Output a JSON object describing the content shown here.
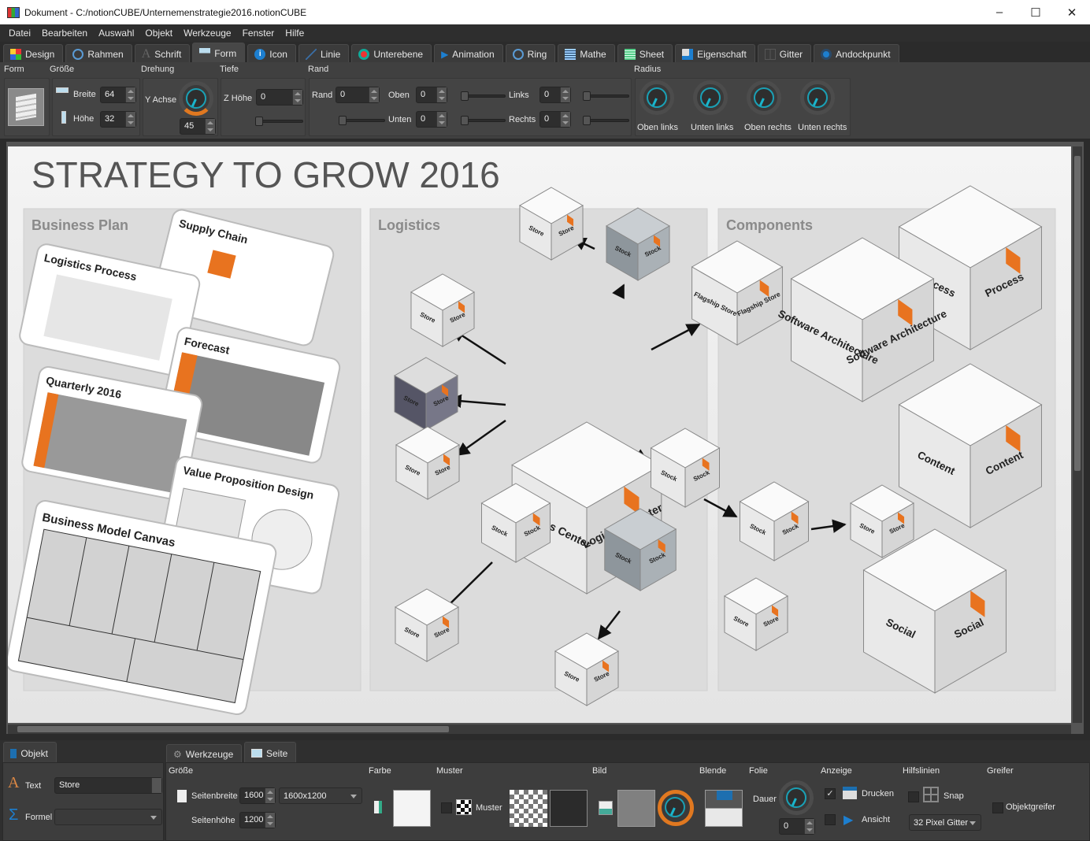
{
  "window": {
    "title": "Dokument - C:/notionCUBE/Unternemenstrategie2016.notionCUBE",
    "minimize": "–",
    "maximize": "☐",
    "close": "✕"
  },
  "menu": [
    "Datei",
    "Bearbeiten",
    "Auswahl",
    "Objekt",
    "Werkzeuge",
    "Fenster",
    "Hilfe"
  ],
  "ribbon_tabs": [
    {
      "label": "Design",
      "icon": "palette-icon"
    },
    {
      "label": "Rahmen",
      "icon": "ring-icon"
    },
    {
      "label": "Schrift",
      "icon": "font-icon"
    },
    {
      "label": "Form",
      "icon": "shape-icon",
      "active": true
    },
    {
      "label": "Icon",
      "icon": "info-icon"
    },
    {
      "label": "Linie",
      "icon": "line-icon"
    },
    {
      "label": "Unterebene",
      "icon": "sublayer-icon"
    },
    {
      "label": "Animation",
      "icon": "play-icon"
    },
    {
      "label": "Ring",
      "icon": "ring-icon"
    },
    {
      "label": "Mathe",
      "icon": "calculator-icon"
    },
    {
      "label": "Sheet",
      "icon": "sheet-icon"
    },
    {
      "label": "Eigenschaft",
      "icon": "property-icon"
    },
    {
      "label": "Gitter",
      "icon": "grid-icon"
    },
    {
      "label": "Andockpunkt",
      "icon": "dock-point-icon"
    }
  ],
  "form_panel": {
    "sections": {
      "form": "Form",
      "size": "Größe",
      "rotation": "Drehung",
      "depth": "Tiefe",
      "border": "Rand",
      "radius": "Radius"
    },
    "width_label": "Breite",
    "width": "64",
    "height_label": "Höhe",
    "height": "32",
    "y_axis_label": "Y Achse",
    "y_axis": "45",
    "z_height_label": "Z Höhe",
    "z_height": "0",
    "border_label": "Rand",
    "border": "0",
    "top_label": "Oben",
    "top": "0",
    "bottom_label": "Unten",
    "bottom": "0",
    "left_label": "Links",
    "left": "0",
    "right_label": "Rechts",
    "right": "0",
    "radius_knobs": [
      "Oben links",
      "Unten links",
      "Oben rechts",
      "Unten rechts"
    ]
  },
  "canvas": {
    "title": "STRATEGY TO GROW  2016",
    "panels": [
      "Business Plan",
      "Logistics",
      "Components"
    ],
    "cards": [
      "Supply Chain",
      "Logistics Process",
      "Forecast",
      "Quarterly 2016",
      "Value Proposition Design",
      "Business Model Canvas"
    ],
    "logistics_center": "Logistics Center",
    "store": "Store",
    "stock": "Stock",
    "flagship": "Flagship Store",
    "components": {
      "process": "Process",
      "software": "Software Architecture",
      "content": "Content",
      "social": "Social"
    }
  },
  "bottom": {
    "left_tab": "Objekt",
    "tabs": [
      "Werkzeuge",
      "Seite"
    ],
    "active_tab": "Seite",
    "text_label": "Text",
    "text_value": "Store",
    "formula_label": "Formel",
    "formula_value": "",
    "sections": {
      "size": "Größe",
      "color": "Farbe",
      "pattern": "Muster",
      "image": "Bild",
      "blend": "Blende",
      "slide": "Folie",
      "display": "Anzeige",
      "guides": "Hilfslinien",
      "snap": "Greifer"
    },
    "page_width_label": "Seitenbreite",
    "page_width": "1600",
    "page_preset": "1600x1200",
    "page_height_label": "Seitenhöhe",
    "page_height": "1200",
    "pattern_label": "Muster",
    "duration_label": "Dauer",
    "duration": "0",
    "print_label": "Drucken",
    "print_checked": true,
    "view_label": "Ansicht",
    "view_checked": false,
    "snap_label": "Snap",
    "grid_option": "32 Pixel Gitter",
    "object_snap_label": "Objektgreifer"
  },
  "colors": {
    "accent": "#1aa0b5",
    "orange": "#e8731f",
    "canvas": "#eeeeee"
  }
}
